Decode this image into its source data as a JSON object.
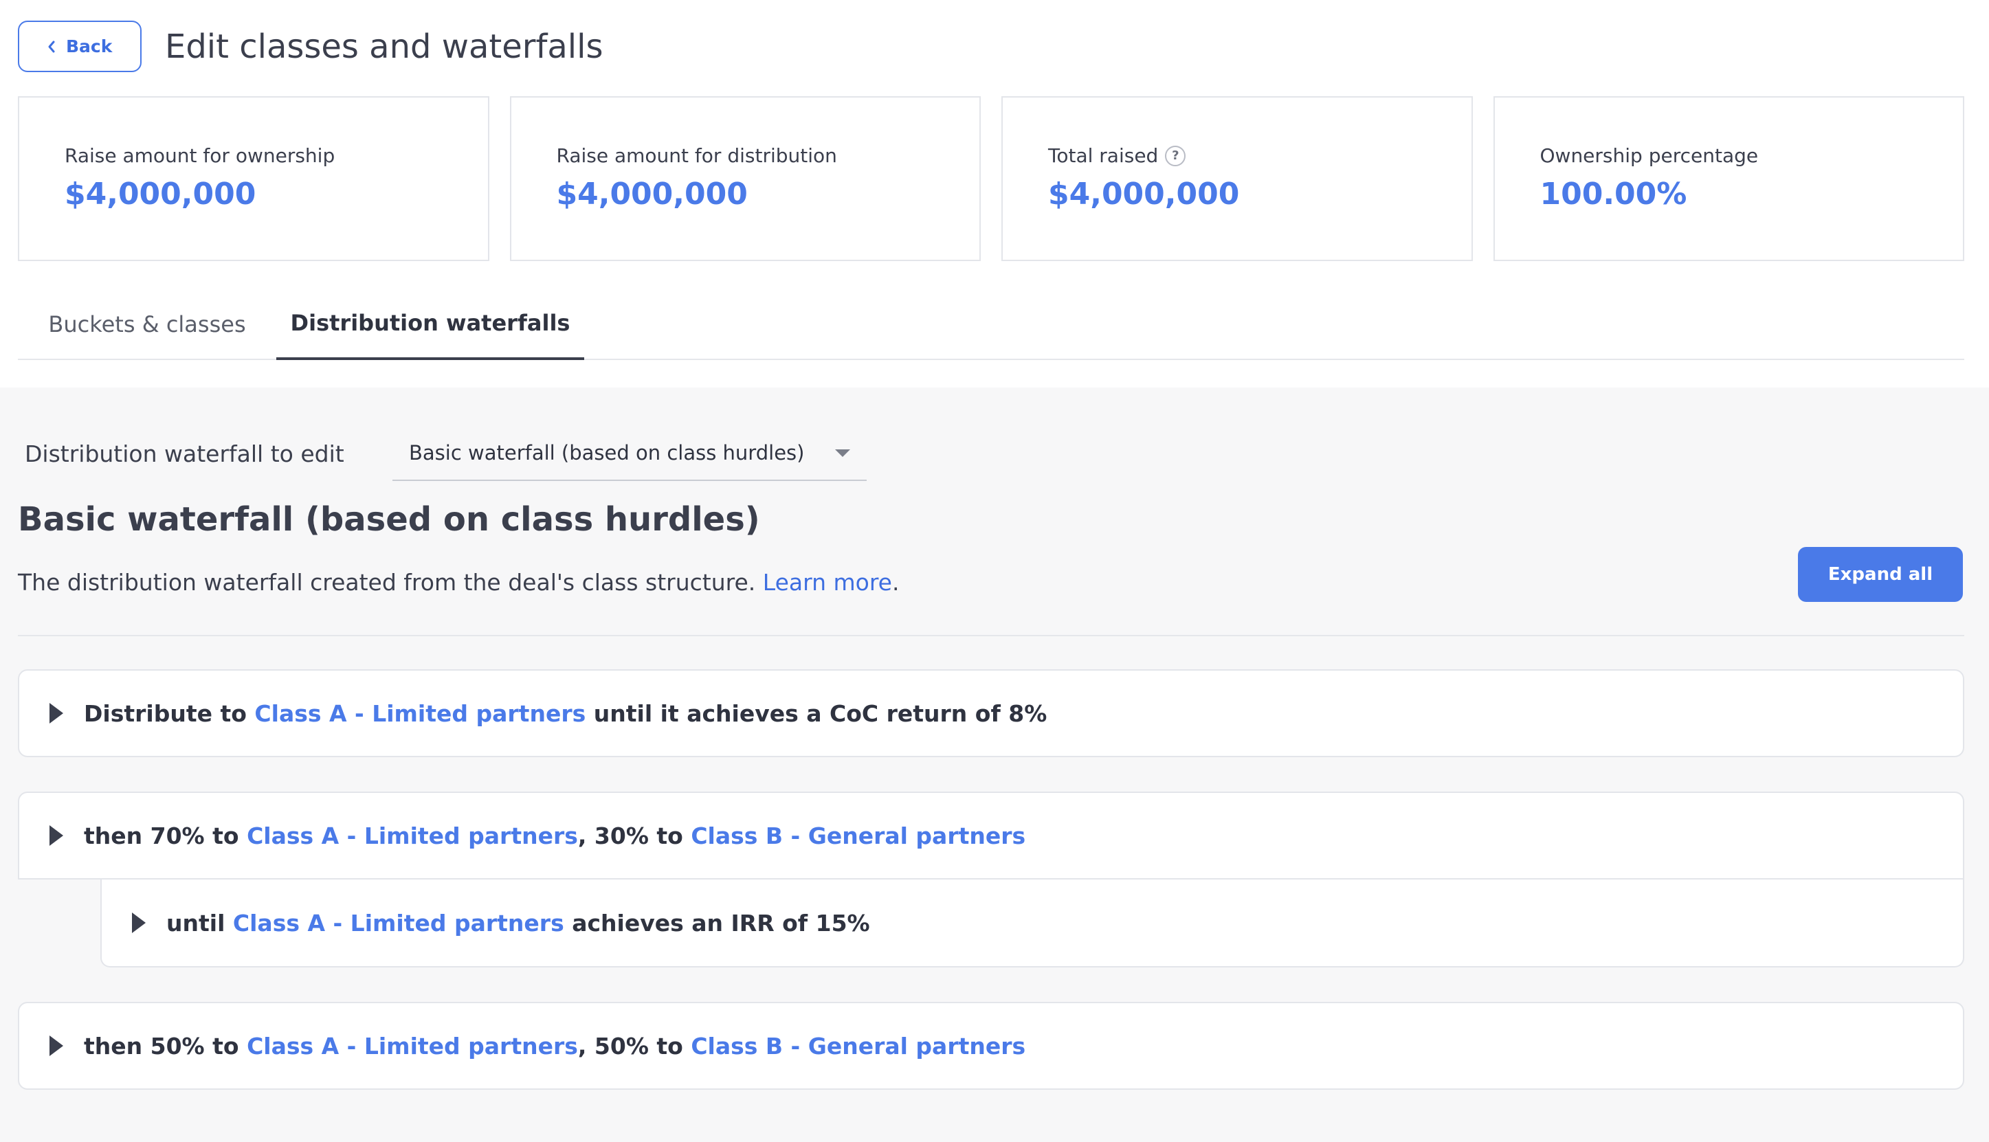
{
  "header": {
    "back_label": "Back",
    "title": "Edit classes and waterfalls"
  },
  "cards": [
    {
      "label": "Raise amount for ownership",
      "value": "$4,000,000"
    },
    {
      "label": "Raise amount for distribution",
      "value": "$4,000,000"
    },
    {
      "label": "Total raised",
      "value": "$4,000,000",
      "help_icon": "?"
    },
    {
      "label": "Ownership percentage",
      "value": "100.00%"
    }
  ],
  "tabs": [
    {
      "label": "Buckets & classes",
      "active": false
    },
    {
      "label": "Distribution waterfalls",
      "active": true
    }
  ],
  "waterfall_select": {
    "label": "Distribution waterfall to edit",
    "value": "Basic waterfall (based on class hurdles)"
  },
  "waterfall": {
    "title": "Basic waterfall (based on class hurdles)",
    "description": "The distribution waterfall created from the deal's class structure.",
    "learn_more": "Learn more",
    "period": ".",
    "expand_all": "Expand all"
  },
  "steps": [
    {
      "pre": "Distribute to",
      "class_a": "Class A - Limited partners",
      "post": "until it achieves a CoC return of 8%"
    },
    {
      "pre": "then 70% to",
      "class_a": "Class A - Limited partners",
      "mid": ", 30% to",
      "class_b": "Class B - General partners",
      "sub": {
        "pre": "until",
        "class_a": "Class A - Limited partners",
        "post": "achieves an IRR of 15%"
      }
    },
    {
      "pre": "then 50% to",
      "class_a": "Class A - Limited partners",
      "mid": ", 50% to",
      "class_b": "Class B - General partners"
    }
  ],
  "colors": {
    "accent": "#4a7ae8",
    "text": "#3b3f4d",
    "section_bg": "#f7f7f8",
    "border": "#e3e5ea"
  },
  "icons": {
    "back": "chevron-left-icon",
    "help": "question-circle-icon",
    "select": "caret-down-icon",
    "row": "caret-right-icon"
  }
}
